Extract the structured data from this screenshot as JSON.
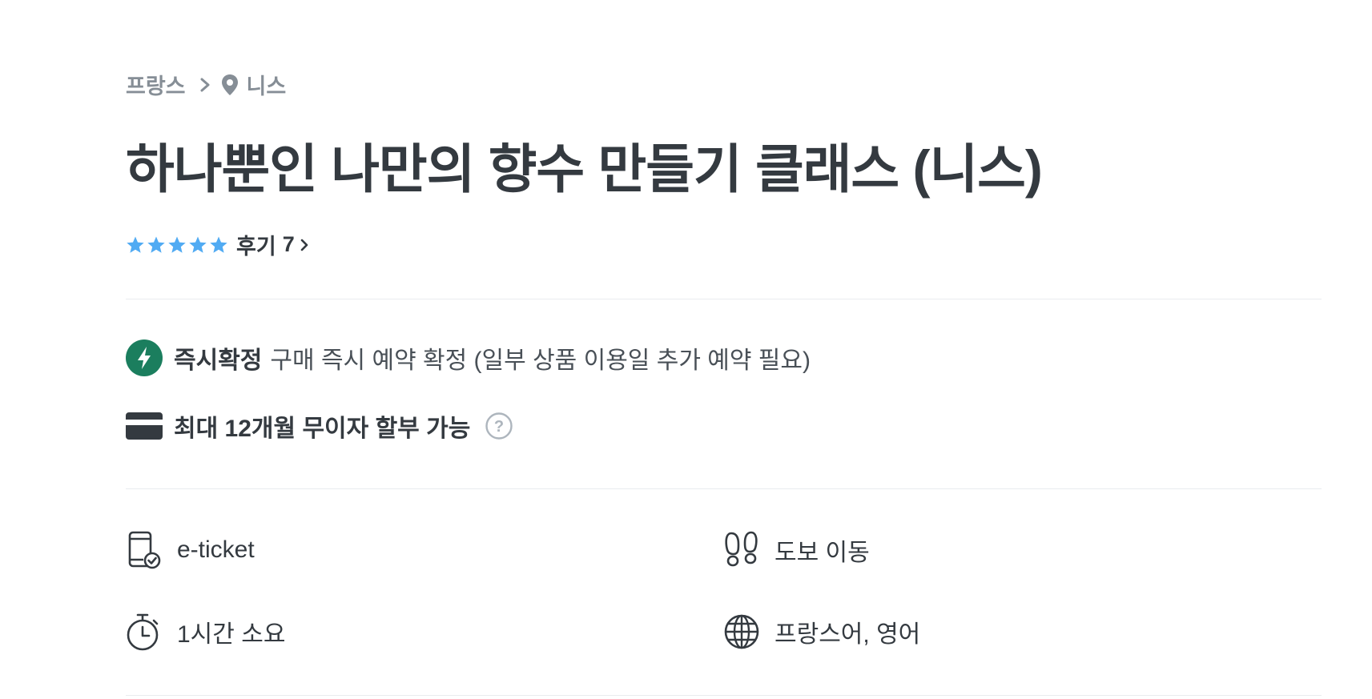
{
  "breadcrumb": {
    "country": "프랑스",
    "city": "니스",
    "icons": [
      "chevron-right-icon",
      "map-pin-icon"
    ]
  },
  "product": {
    "title": "하나뿐인 나만의 향수 만들기 클래스 (니스)"
  },
  "rating": {
    "stars": 5,
    "max_stars": 5,
    "review_label": "후기",
    "review_count": "7",
    "star_color": "#51abf3"
  },
  "instant_confirm": {
    "label": "즉시확정",
    "description": "구매 즉시 예약 확정 (일부 상품 이용일 추가 예약 필요)",
    "badge_color": "#1b7e5e",
    "icon": "lightning-bolt-icon"
  },
  "installment": {
    "label": "최대 12개월 무이자 할부 가능",
    "icon": "credit-card-icon",
    "help_icon": "question-circle-icon"
  },
  "features": [
    {
      "icon": "mobile-ticket-icon",
      "text": "e-ticket"
    },
    {
      "icon": "footprints-icon",
      "text": "도보 이동"
    },
    {
      "icon": "stopwatch-icon",
      "text": "1시간 소요"
    },
    {
      "icon": "globe-icon",
      "text": "프랑스어, 영어"
    }
  ]
}
